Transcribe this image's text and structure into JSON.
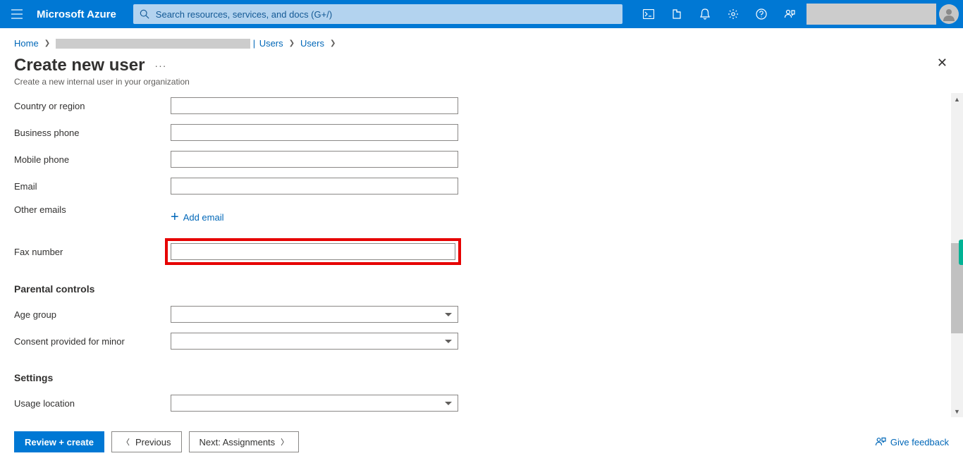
{
  "brand": "Microsoft Azure",
  "search": {
    "placeholder": "Search resources, services, and docs (G+/)"
  },
  "crumbs": {
    "home": "Home",
    "users1": "Users",
    "users2": "Users"
  },
  "page": {
    "title": "Create new user",
    "subtitle": "Create a new internal user in your organization",
    "more": "···"
  },
  "labels": {
    "country": "Country or region",
    "businessPhone": "Business phone",
    "mobilePhone": "Mobile phone",
    "email": "Email",
    "otherEmails": "Other emails",
    "addEmail": "Add email",
    "fax": "Fax number",
    "parental": "Parental controls",
    "ageGroup": "Age group",
    "consent": "Consent provided for minor",
    "settings": "Settings",
    "usageLocation": "Usage location"
  },
  "values": {
    "country": "",
    "businessPhone": "",
    "mobilePhone": "",
    "email": "",
    "fax": "",
    "ageGroup": "",
    "consent": "",
    "usageLocation": ""
  },
  "footer": {
    "review": "Review + create",
    "previous": "Previous",
    "next": "Next: Assignments",
    "feedback": "Give feedback"
  }
}
